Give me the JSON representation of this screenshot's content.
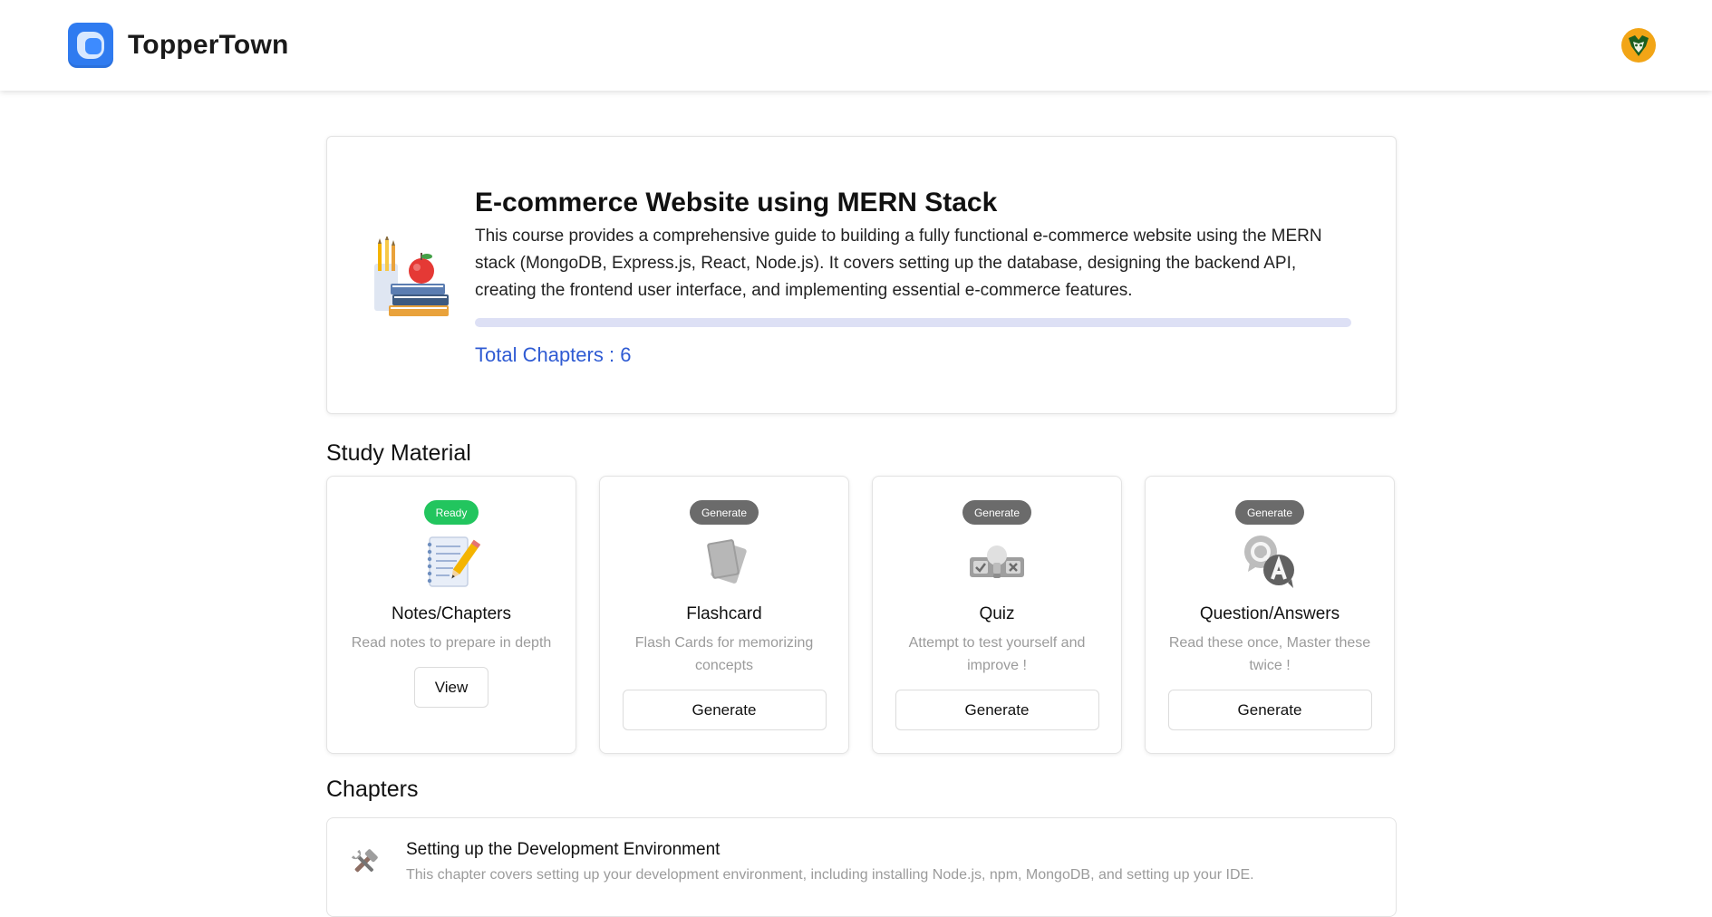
{
  "header": {
    "brand_name": "TopperTown",
    "logo_icon": "app-logo-icon",
    "avatar_icon": "user-avatar"
  },
  "course": {
    "title": "E-commerce Website using MERN Stack",
    "description": "This course provides a comprehensive guide to building a fully functional e-commerce website using the MERN stack (MongoDB, Express.js, React, Node.js). It covers setting up the database, designing the backend API, creating the frontend user interface, and implementing essential e-commerce features.",
    "progress_percent": 0,
    "total_chapters_label": "Total Chapters : 6",
    "illustration_icon": "books-apple-illustration"
  },
  "study_material": {
    "title": "Study Material",
    "items": [
      {
        "badge": "Ready",
        "title": "Notes/Chapters",
        "description": "Read notes to prepare in depth",
        "button": "View",
        "icon": "notepad-icon"
      },
      {
        "badge": "Generate",
        "title": "Flashcard",
        "description": "Flash Cards for memorizing concepts",
        "button": "Generate",
        "icon": "flashcard-icon"
      },
      {
        "badge": "Generate",
        "title": "Quiz",
        "description": "Attempt to test yourself and improve !",
        "button": "Generate",
        "icon": "quiz-icon"
      },
      {
        "badge": "Generate",
        "title": "Question/Answers",
        "description": "Read these once, Master these twice !",
        "button": "Generate",
        "icon": "qa-icon"
      }
    ]
  },
  "chapters": {
    "title": "Chapters",
    "items": [
      {
        "title": "Setting up the Development Environment",
        "description": "This chapter covers setting up your development environment, including installing Node.js, npm, MongoDB, and setting up your IDE.",
        "icon": "tools-icon"
      }
    ]
  },
  "colors": {
    "brand": "#2f7bf0",
    "link": "#2f5bd3",
    "ready": "#22c55e",
    "generate": "#6b6b6b",
    "progress_track": "#dde0f5"
  }
}
